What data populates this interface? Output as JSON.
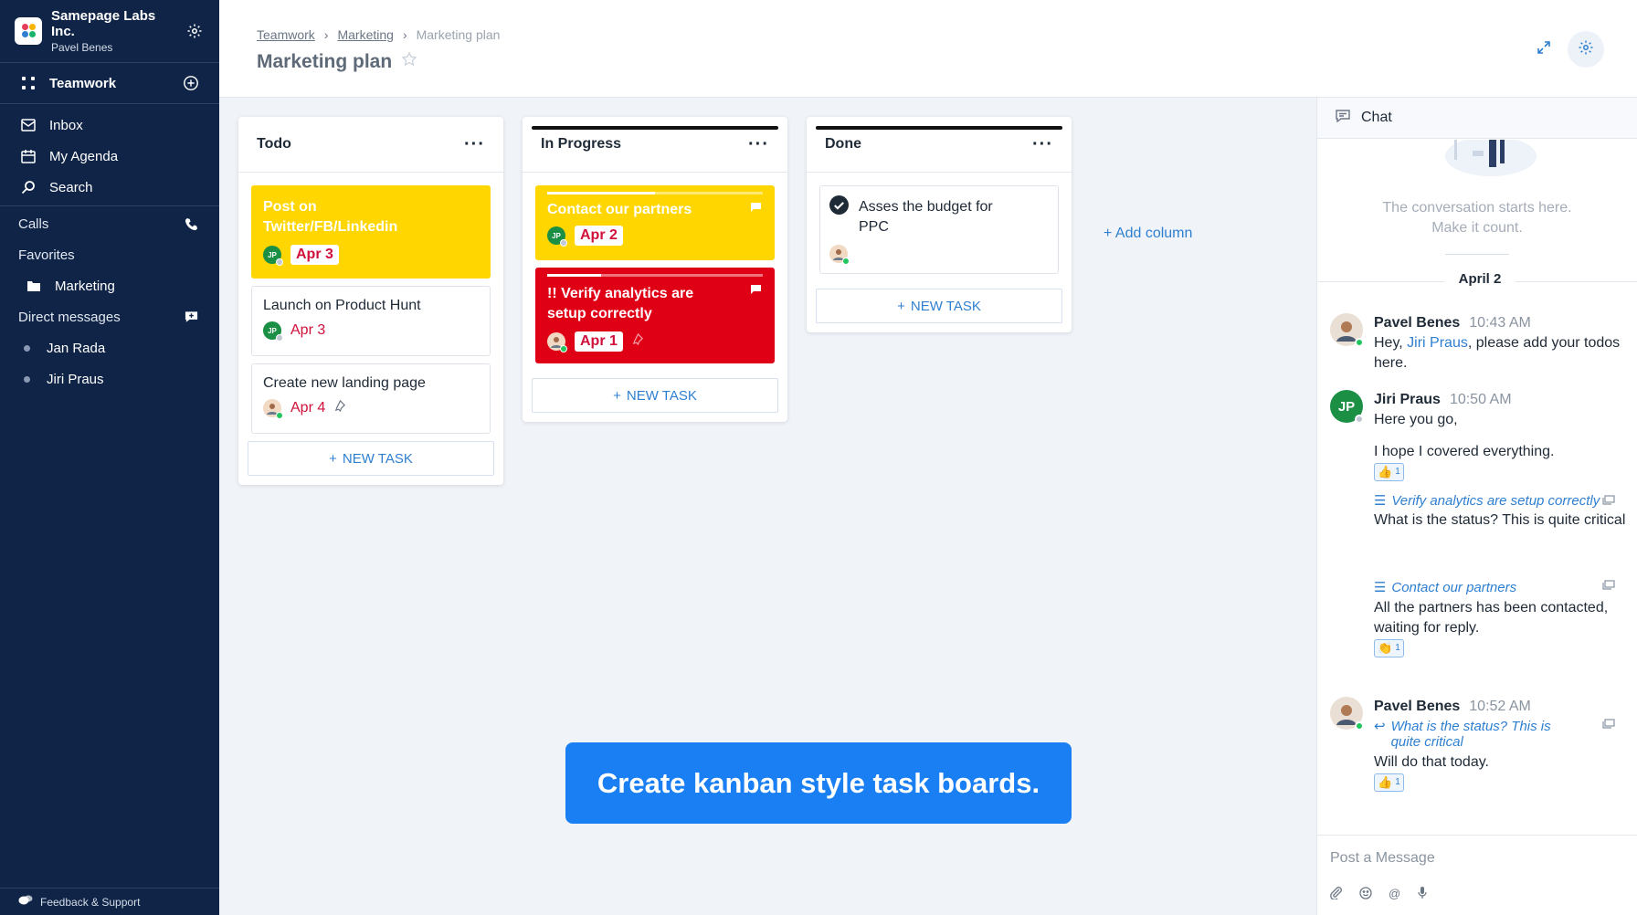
{
  "org": {
    "name": "Samepage Labs Inc.",
    "user": "Pavel Benes"
  },
  "sidebar": {
    "main_label": "Teamwork",
    "nav": [
      {
        "label": "Inbox",
        "icon": "inbox-icon"
      },
      {
        "label": "My Agenda",
        "icon": "calendar-icon"
      },
      {
        "label": "Search",
        "icon": "search-icon"
      }
    ],
    "calls_label": "Calls",
    "favorites_label": "Favorites",
    "favorite_items": [
      {
        "label": "Marketing",
        "icon": "folder-icon"
      }
    ],
    "dm_label": "Direct messages",
    "dm_items": [
      {
        "label": "Jan Rada"
      },
      {
        "label": "Jiri Praus"
      }
    ],
    "footer_label": "Feedback & Support"
  },
  "header": {
    "breadcrumbs": [
      "Teamwork",
      "Marketing",
      "Marketing plan"
    ],
    "title": "Marketing plan"
  },
  "board": {
    "columns": [
      {
        "title": "Todo",
        "cards": [
          {
            "title": "Post on Twitter/FB/Linkedin",
            "date": "Apr 3",
            "assignee": "JP"
          },
          {
            "title": "Launch on Product Hunt",
            "date": "Apr 3",
            "assignee": "JP"
          },
          {
            "title": "Create new landing page",
            "date": "Apr 4",
            "assignee": "PB"
          }
        ],
        "new_task": "NEW TASK"
      },
      {
        "title": "In Progress",
        "cards": [
          {
            "title": "Contact our partners",
            "date": "Apr 2",
            "assignee": "JP",
            "progress": 0.5
          },
          {
            "title": "!! Verify analytics are setup correctly",
            "date": "Apr 1",
            "assignee": "PB",
            "progress": 0.25
          }
        ],
        "new_task": "NEW TASK"
      },
      {
        "title": "Done",
        "cards": [
          {
            "title": "Asses the budget for PPC",
            "assignee": "PB"
          }
        ],
        "new_task": "NEW TASK"
      }
    ],
    "add_column": "+ Add column"
  },
  "banner": "Create kanban style task boards.",
  "chat": {
    "title": "Chat",
    "empty_line1": "The conversation starts here.",
    "empty_line2": "Make it count.",
    "day": "April 2",
    "messages": {
      "m1": {
        "name": "Pavel Benes",
        "time": "10:43 AM",
        "pre": "Hey, ",
        "mention": "Jiri Praus",
        "post": ", please add your todos here."
      },
      "m2": {
        "name": "Jiri Praus",
        "initials": "JP",
        "time": "10:50 AM",
        "text1": "Here you go,",
        "text2": "I hope I covered everything.",
        "react_count": "1"
      },
      "m3": {
        "ref": "Verify analytics are setup correctly",
        "text": "What is the status? This is quite critical"
      },
      "m4": {
        "ref": "Contact our partners",
        "text": "All the partners has been contacted, waiting for reply.",
        "react_count": "1"
      },
      "m5": {
        "name": "Pavel Benes",
        "time": "10:52 AM",
        "ref": "What is the status? This is quite critical",
        "text": "Will do that today.",
        "react_count": "1"
      }
    },
    "composer_placeholder": "Post a Message"
  },
  "colors": {
    "sidebar": "#0f2446",
    "accent": "#1a7ff2",
    "yellow": "#ffd600",
    "red": "#e00016",
    "date": "#d0103a"
  }
}
